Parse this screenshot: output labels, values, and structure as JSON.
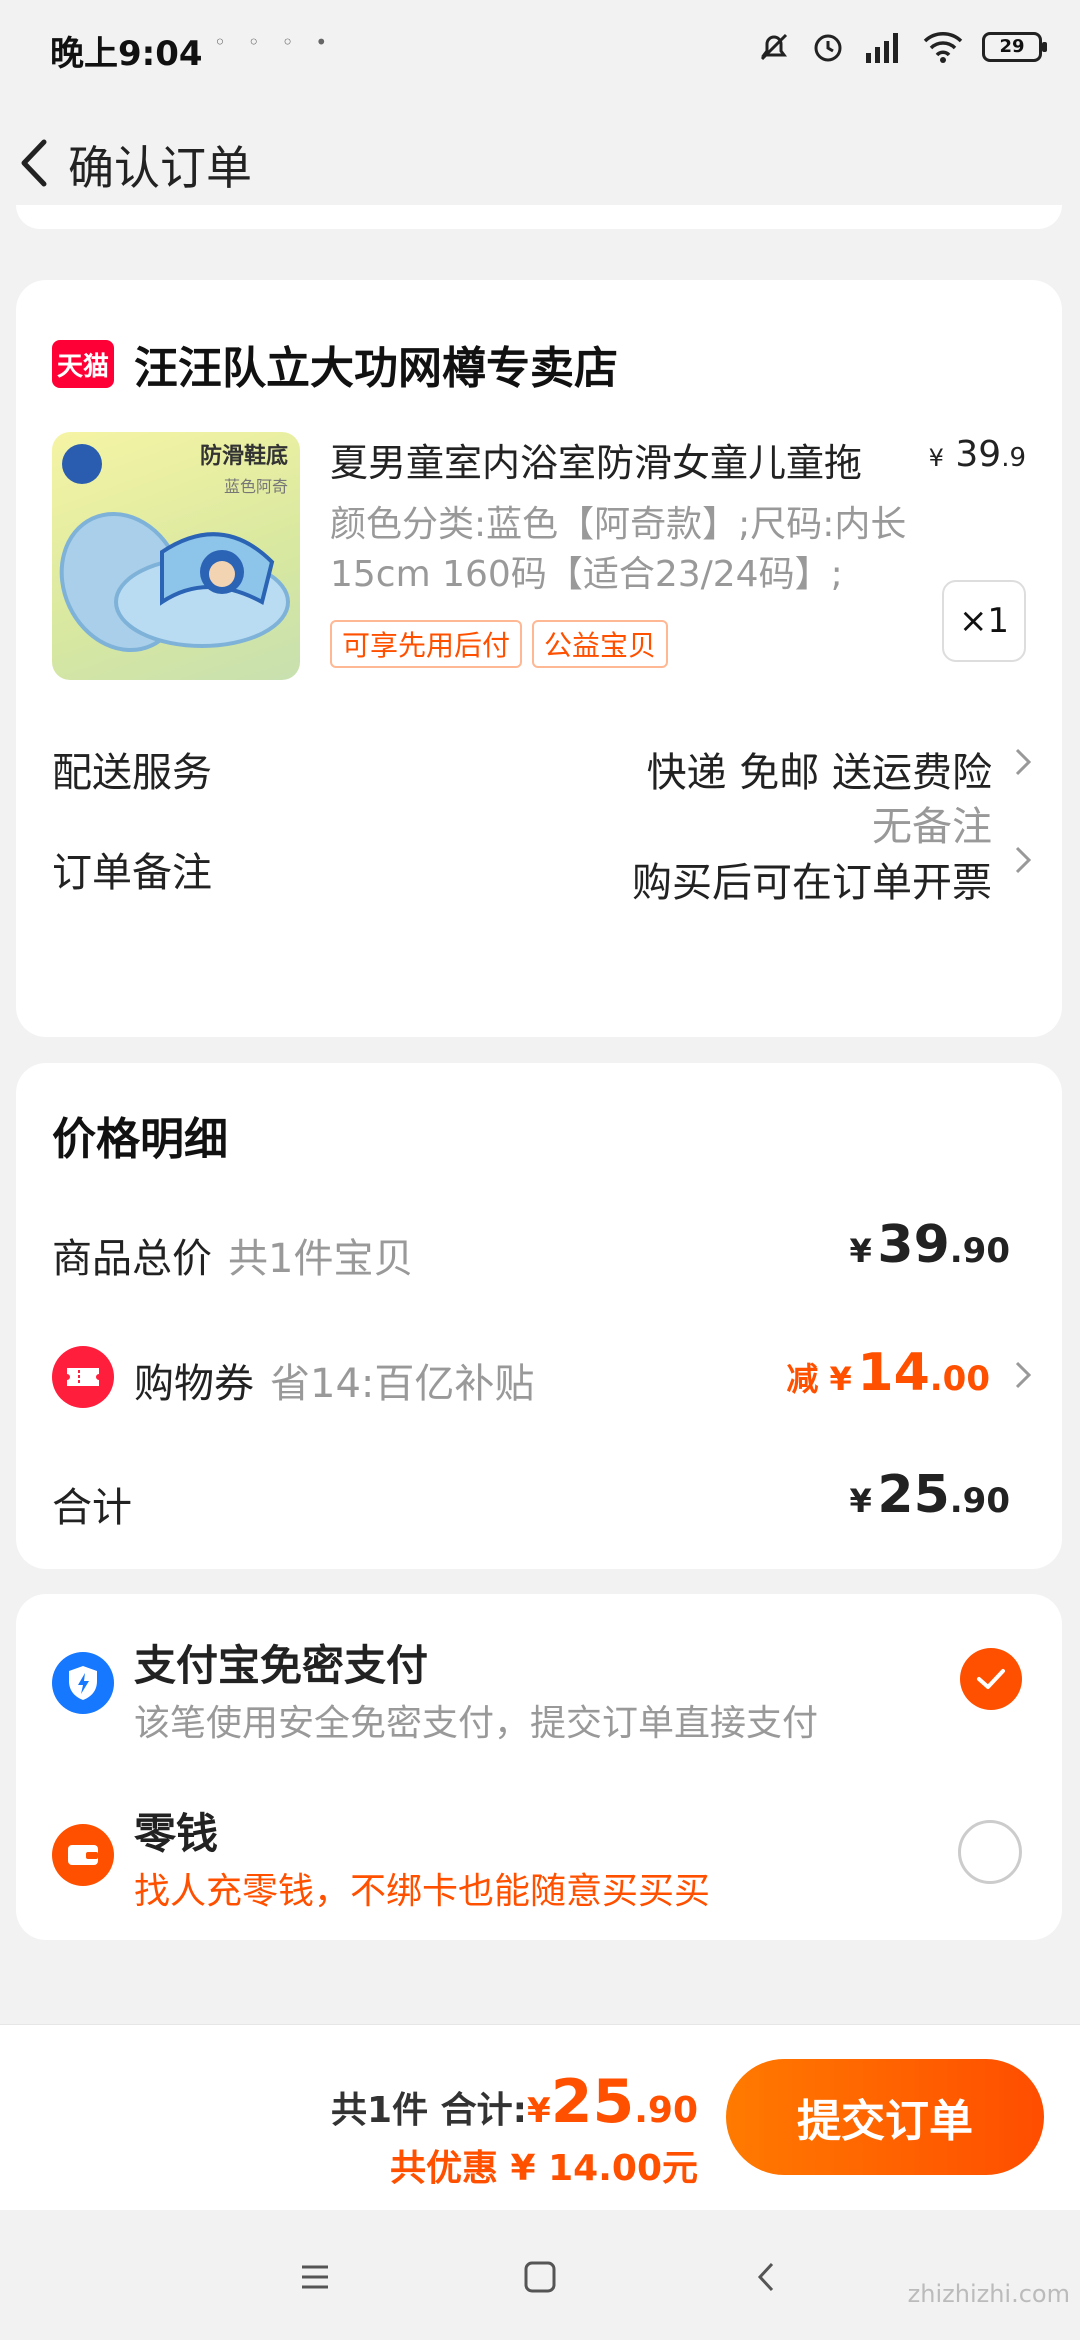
{
  "status_bar": {
    "time": "晚上9:04",
    "battery": "29",
    "icons": [
      "notification-icons",
      "mute-icon",
      "alarm-icon",
      "signal-icon",
      "wifi-icon",
      "battery-icon"
    ]
  },
  "nav": {
    "title": "确认订单",
    "back_icon": "chevron-left-icon"
  },
  "order": {
    "store_badge": "天猫",
    "store_name": "汪汪队立大功网樽专卖店",
    "item": {
      "title": "夏男童室内浴室防滑女童儿童拖",
      "price_currency": "¥",
      "price_int": "39",
      "price_dec": ".9",
      "sku": "颜色分类:蓝色【阿奇款】;尺码:内长15cm 160码【适合23/24码】;",
      "thumb_text": "防滑鞋底",
      "thumb_sub": "蓝色阿奇",
      "tags": [
        "可享先用后付",
        "公益宝贝"
      ],
      "quantity": "×1"
    },
    "delivery": {
      "label": "配送服务",
      "value": "快递 免邮 送运费险"
    },
    "remark": {
      "label": "订单备注",
      "line1": "无备注",
      "line2": "购买后可在订单开票"
    }
  },
  "price_detail": {
    "title": "价格明细",
    "goods_total": {
      "label": "商品总价",
      "sub": "共1件宝贝",
      "currency": "¥",
      "int": "39",
      "dec": ".90"
    },
    "coupon": {
      "label": "购物券",
      "sub": "省14:百亿补贴",
      "prefix": "减 ¥",
      "int": "14",
      "dec": ".00"
    },
    "total": {
      "label": "合计",
      "currency": "¥",
      "int": "25",
      "dec": ".90"
    }
  },
  "payment": {
    "options": [
      {
        "title": "支付宝免密支付",
        "sub": "该笔使用安全免密支付，提交订单直接支付",
        "selected": true
      },
      {
        "title": "零钱",
        "sub": "找人充零钱，不绑卡也能随意买买买",
        "selected": false
      }
    ]
  },
  "bottom": {
    "count": "共1件",
    "sum_label": "合计:",
    "currency": "¥",
    "int": "25",
    "dec": ".90",
    "discount": "共优惠 ¥ 14.00元",
    "submit": "提交订单"
  },
  "watermark": "zhizhizhi.com",
  "colors": {
    "accent": "#ff5000",
    "tmall": "#ff0036",
    "alipay": "#1677ff",
    "coupon": "#ff1e3c"
  }
}
